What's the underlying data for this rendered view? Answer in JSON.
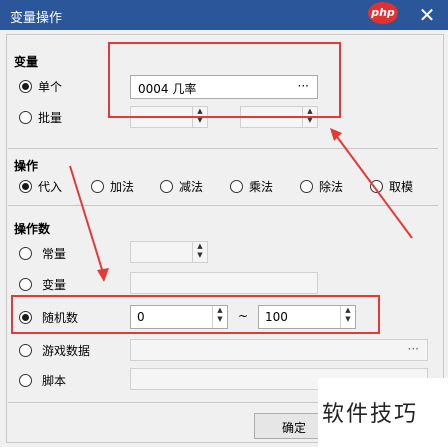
{
  "window": {
    "title": "变量操作",
    "close_glyph": "✕",
    "logo_text": "php"
  },
  "variable": {
    "section": "变量",
    "single_label": "单个",
    "single_selected": true,
    "single_value": "0004 几率",
    "browse_glyph": "···",
    "batch_label": "批量",
    "batch_sep": "~"
  },
  "operation": {
    "section": "操作",
    "options": [
      "代入",
      "加法",
      "减法",
      "乘法",
      "除法",
      "取模"
    ],
    "selected": "代入"
  },
  "operand": {
    "section": "操作数",
    "constant_label": "常量",
    "variable_label": "变量",
    "random_label": "随机数",
    "random_selected": true,
    "random_min": "0",
    "random_max": "100",
    "random_sep": "~",
    "gamedata_label": "游戏数据",
    "script_label": "脚本",
    "browse_glyph": "···"
  },
  "footer": {
    "ok_label": "确定"
  },
  "watermark": {
    "text": "软件技巧"
  },
  "colors": {
    "titlebar": "#2b579a",
    "highlight": "#e53935"
  }
}
